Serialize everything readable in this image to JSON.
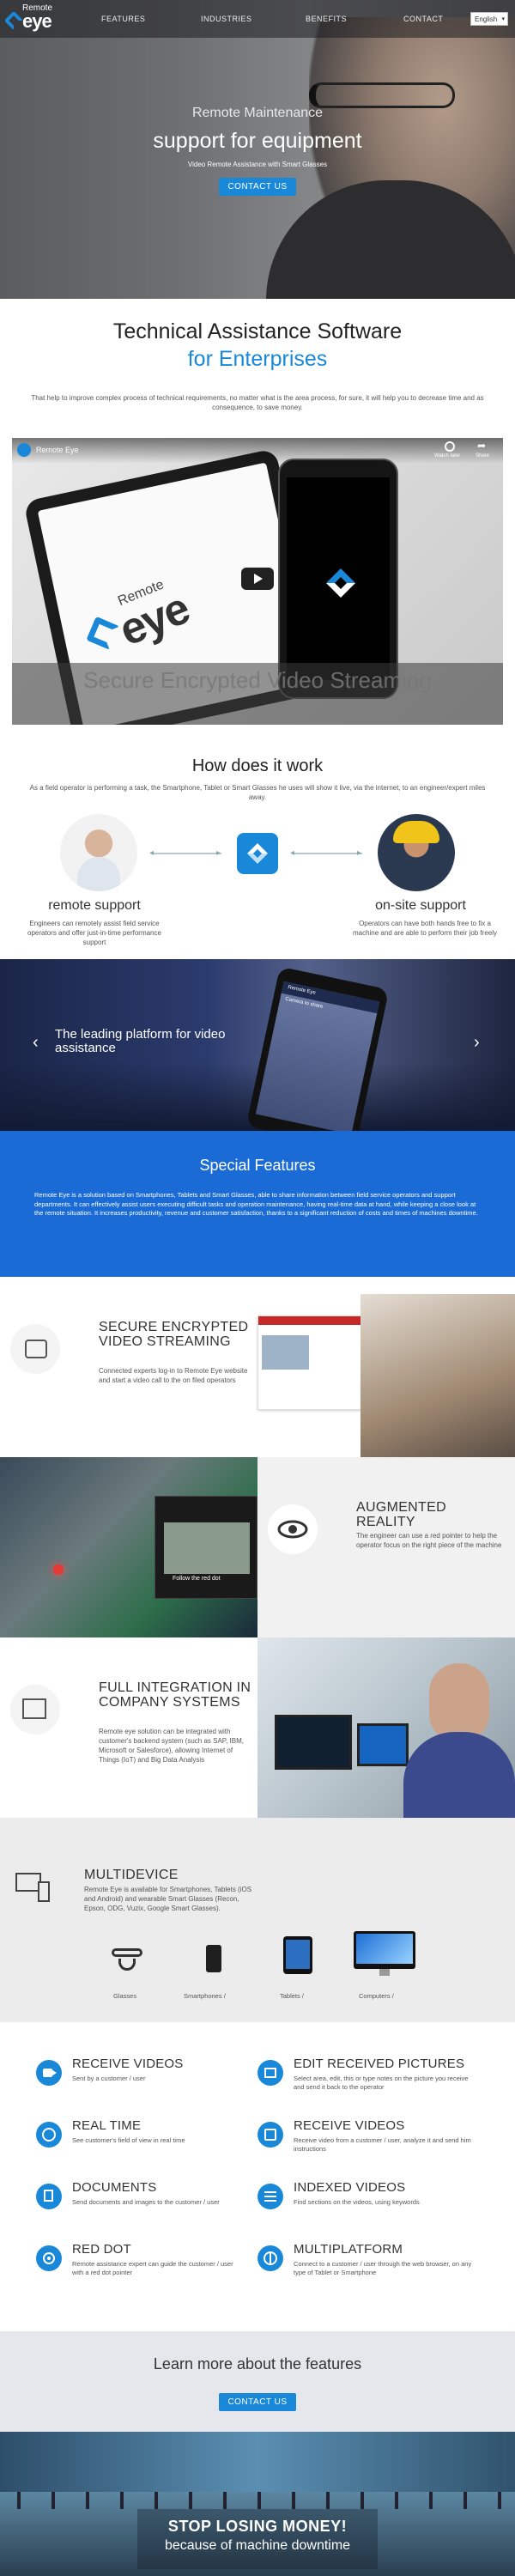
{
  "nav": {
    "logo_top": "Remote",
    "logo_main": "eye",
    "items": [
      {
        "label": "FEATURES"
      },
      {
        "label": "INDUSTRIES"
      },
      {
        "label": "BENEFITS"
      },
      {
        "label": "CONTACT"
      }
    ],
    "language": "English"
  },
  "hero": {
    "line1": "Remote Maintenance",
    "line2": "support for equipment",
    "line3": "Video Remote Assistance with Smart Glasses",
    "cta": "CONTACT US"
  },
  "intro": {
    "title": "Technical Assistance Software",
    "subtitle": "for Enterprises",
    "text": "That help to improve complex process of technical requirements, no matter what is the area process, for sure, it will help you to decrease time and as consequence, to save money."
  },
  "video": {
    "channel": "Remote Eye",
    "watch_later": "Watch later",
    "share": "Share",
    "overlay": "Secure Encrypted Video Streaming",
    "tablet_logo_top": "Remote",
    "tablet_logo_main": "eye"
  },
  "how": {
    "title": "How does it work",
    "text": "As a field operator is performing a task, the Smartphone, Tablet or Smart Glasses he uses will show it live, via the internet, to an engineer/expert miles away.",
    "left_caption": "remote support",
    "left_text": "Engineers can remotely assist field service operators and offer just-in-time performance support",
    "right_caption": "on-site support",
    "right_text": "Operators can have both hands free to fix a machine and are able to perform their job freely"
  },
  "carousel": {
    "text": "The leading platform for video assistance",
    "prev": "‹",
    "next": "›",
    "phone_title": "Remote Eye",
    "phone_caption": "Camera to share"
  },
  "special": {
    "title": "Special Features",
    "text": "Remote Eye is a solution based on Smartphones, Tablets and Smart Glasses, able to share information between field service operators and support departments. It can effectively assist users executing difficult tasks and operation maintenance, having real-time data at hand, while keeping a close look at the remote situation. It increases productivity, revenue and customer satisfaction, thanks to a significant reduction of costs and times of machines downtime."
  },
  "blocks": [
    {
      "title": "SECURE ENCRYPTED VIDEO STREAMING",
      "text": "Connected experts log-in to Remote Eye website and start a video call to the on filed operators"
    },
    {
      "title": "AUGMENTED REALITY",
      "text": "The engineer can use a red pointer to help the operator focus on the right piece of the machine"
    },
    {
      "title": "FULL INTEGRATION IN COMPANY SYSTEMS",
      "text": "Remote eye solution can be integrated with customer's backend system (such as SAP, IBM, Microsoft or Salesforce), allowing Internet of Things (IoT) and Big Data Analysis"
    }
  ],
  "ar_caption": "Follow the red dot",
  "multidevice": {
    "title": "MULTIDEVICE",
    "text": "Remote Eye is available for Smartphones, Tablets (iOS and Android) and wearable Smart Glasses (Recon, Epson, ODG, Vuzix, Google Smart Glasses).",
    "devices": [
      {
        "label": "Glasses"
      },
      {
        "label": "Smartphones  / "
      },
      {
        "label": "Tablets  / "
      },
      {
        "label": "Computers  / "
      }
    ]
  },
  "grid": [
    {
      "title": "RECEIVE VIDEOS",
      "text": "Sent by a customer / user",
      "icon": "video-camera-icon"
    },
    {
      "title": "EDIT RECEIVED PICTURES",
      "text": "Select area, edit, this or type notes on the picture you receive and send it back to the operator",
      "icon": "image-edit-icon"
    },
    {
      "title": "REAL TIME",
      "text": "See customer's field of view in real time",
      "icon": "clock-icon"
    },
    {
      "title": "RECEIVE VIDEOS",
      "text": "Receive video from a customer / user, analyze it and send him instructions",
      "icon": "edit-icon"
    },
    {
      "title": "DOCUMENTS",
      "text": "Send documents and images to the customer / user",
      "icon": "documents-icon"
    },
    {
      "title": "INDEXED VIDEOS",
      "text": "Find sections on the videos, using keywords",
      "icon": "list-icon"
    },
    {
      "title": "RED DOT",
      "text": "Remote assistance expert can guide the customer / user with a red dot pointer",
      "icon": "red-dot-icon"
    },
    {
      "title": "MULTIPLATFORM",
      "text": "Connect to a customer / user through the web browser, on any type of Tablet or Smartphone",
      "icon": "globe-icon"
    }
  ],
  "learn": {
    "title": "Learn more about the features",
    "cta": "CONTACT US"
  },
  "bottom": {
    "line1": "STOP LOSING MONEY!",
    "line2": "because of machine downtime"
  },
  "colors": {
    "accent": "#1a88d8",
    "feature_band": "#1a6bd6"
  }
}
